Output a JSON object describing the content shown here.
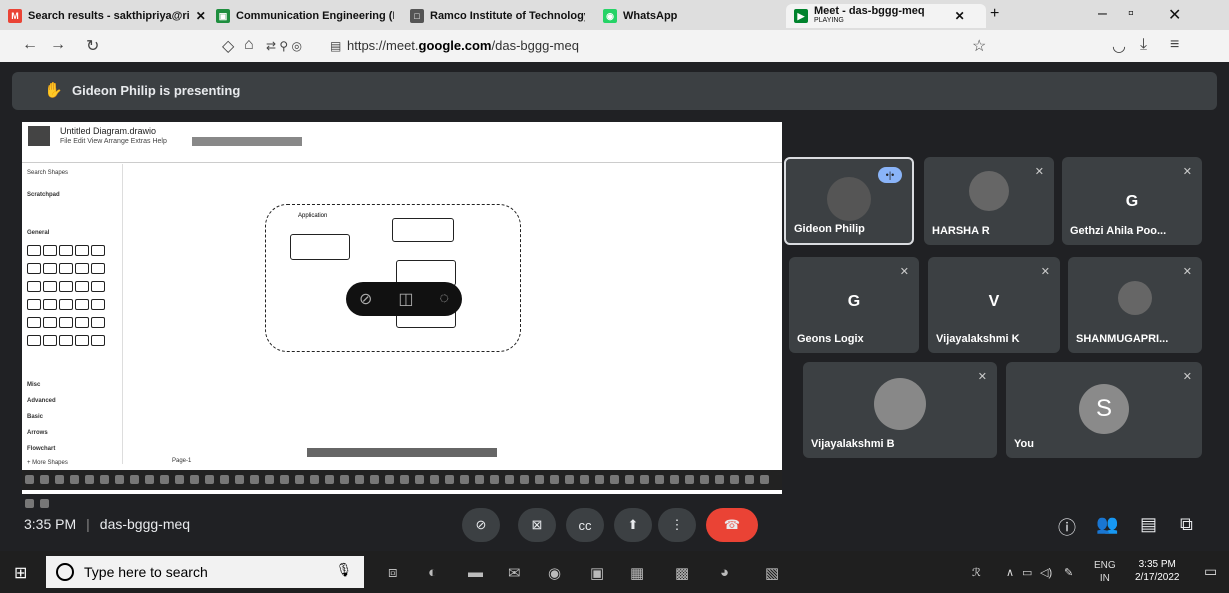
{
  "browser": {
    "tabs": [
      {
        "icon": "gmail-icon",
        "label": "Search results - sakthipriya@ri"
      },
      {
        "icon": "classroom-icon",
        "label": "Communication Engineering (I"
      },
      {
        "icon": "site-icon",
        "label": "Ramco Institute of Technology"
      },
      {
        "icon": "whatsapp-icon",
        "label": "WhatsApp"
      },
      {
        "icon": "meet-icon",
        "label": "Meet - das-bggg-meq",
        "sublabel": "PLAYING"
      }
    ],
    "url_prefix": "https://meet.",
    "url_domain": "google.com",
    "url_path": "/das-bggg-meq"
  },
  "meet": {
    "presenting_text": "Gideon Philip is presenting",
    "meeting_time": "3:35 PM",
    "meeting_code": "das-bggg-meq",
    "participants": [
      {
        "name": "Gideon Philip",
        "speaking": true
      },
      {
        "name": "HARSHA R"
      },
      {
        "name": "Gethzi Ahila Poo...",
        "initial": "G"
      },
      {
        "name": "Geons Logix",
        "initial": "G"
      },
      {
        "name": "Vijayalakshmi K",
        "initial": "V"
      },
      {
        "name": "SHANMUGAPRI..."
      },
      {
        "name": "Vijayalakshmi B"
      },
      {
        "name": "You",
        "initial": "S"
      }
    ],
    "controls": {
      "captions": "cc"
    }
  },
  "presentation": {
    "doc_title": "Untitled Diagram.drawio",
    "menu": "File  Edit  View  Arrange  Extras  Help",
    "sidebar_search": "Search Shapes",
    "sidebar_sections": [
      "Scratchpad",
      "General",
      "Misc",
      "Advanced",
      "Basic",
      "Arrows",
      "Flowchart"
    ],
    "more_shapes": "+ More Shapes",
    "page_tab": "Page-1",
    "node_app": "Application"
  },
  "taskbar": {
    "search_placeholder": "Type here to search",
    "lang": "ENG",
    "region": "IN",
    "time": "3:35 PM",
    "date": "2/17/2022"
  }
}
